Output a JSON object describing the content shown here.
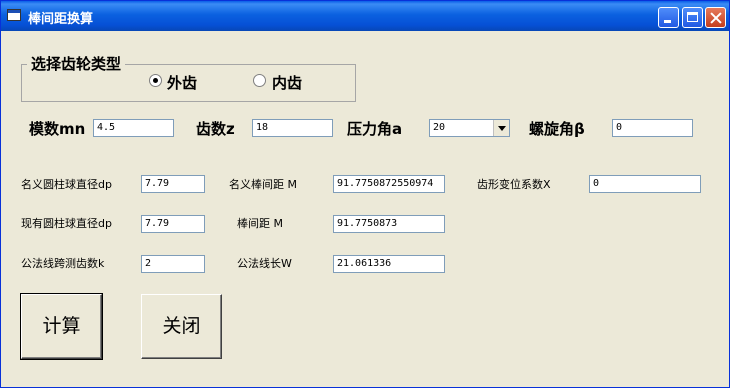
{
  "window": {
    "title": "棒间距换算"
  },
  "gear_type": {
    "group_label": "选择齿轮类型",
    "external_label": "外齿",
    "internal_label": "内齿",
    "selected": "外齿"
  },
  "params": {
    "module_label": "模数mn",
    "module_value": "4.5",
    "teeth_label": "齿数z",
    "teeth_value": "18",
    "pressure_label": "压力角a",
    "pressure_value": "20",
    "helix_label": "螺旋角β",
    "helix_value": "0"
  },
  "results": {
    "nominal_ball_label": "名义圆柱球直径dp",
    "nominal_ball_value": "7.79",
    "nominal_dist_label": "名义棒间距 M",
    "nominal_dist_value": "91.7750872550974",
    "shift_label": "齿形变位系数X",
    "shift_value": "0",
    "actual_ball_label": "现有圆柱球直径dp",
    "actual_ball_value": "7.79",
    "dist_label": "棒间距 M",
    "dist_value": "91.7750873",
    "span_teeth_label": "公法线跨测齿数k",
    "span_teeth_value": "2",
    "span_len_label": "公法线长W",
    "span_len_value": "21.061336"
  },
  "buttons": {
    "calculate": "计算",
    "close": "关闭"
  }
}
